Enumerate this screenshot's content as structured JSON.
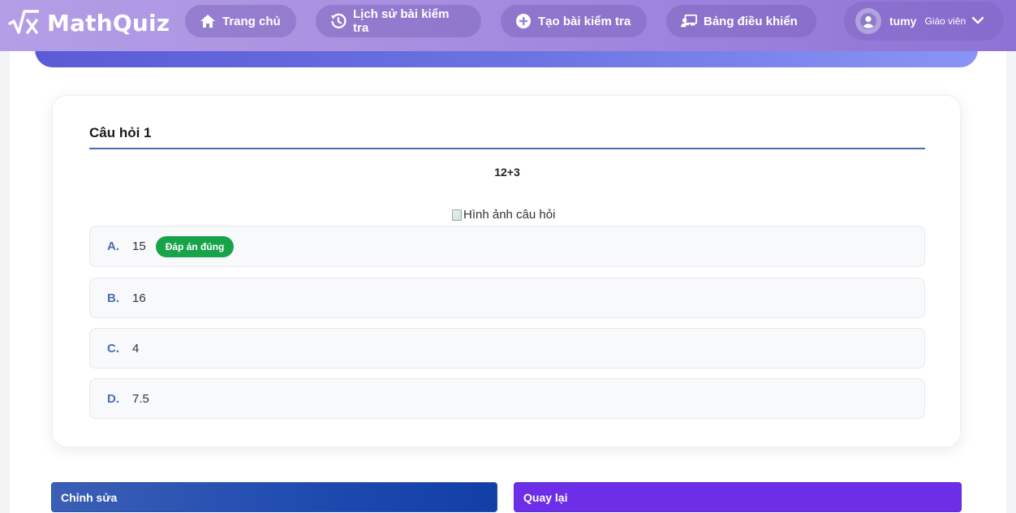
{
  "app": {
    "name": "MathQuiz",
    "logo_icon": "sqrt-x-icon"
  },
  "nav": {
    "home": {
      "label": "Trang chủ",
      "icon": "home-icon"
    },
    "history": {
      "label": "Lịch sử bài kiểm tra",
      "icon": "history-icon"
    },
    "create": {
      "label": "Tạo bài kiểm tra",
      "icon": "plus-circle-icon"
    },
    "dashboard": {
      "label": "Bảng điều khiển",
      "icon": "teacher-board-icon"
    },
    "user": {
      "name": "tumy",
      "role": "Giáo viên",
      "avatar_icon": "user-circle-icon",
      "dropdown_icon": "chevron-down-icon"
    }
  },
  "question": {
    "title": "Câu hỏi 1",
    "text": "12+3",
    "image_alt": "Hình ảnh câu hỏi",
    "correct_badge": "Đáp án đúng",
    "options": [
      {
        "letter": "A.",
        "value": "15",
        "correct": true
      },
      {
        "letter": "B.",
        "value": "16",
        "correct": false
      },
      {
        "letter": "C.",
        "value": "4",
        "correct": false
      },
      {
        "letter": "D.",
        "value": "7.5",
        "correct": false
      }
    ]
  },
  "actions": {
    "edit_label": "Chỉnh sửa",
    "back_label": "Quay lại"
  },
  "colors": {
    "accent": "#4d6bb5",
    "correct": "#16a34a",
    "back_button": "#6d2ee8",
    "edit_button": "#1e4ab0"
  }
}
